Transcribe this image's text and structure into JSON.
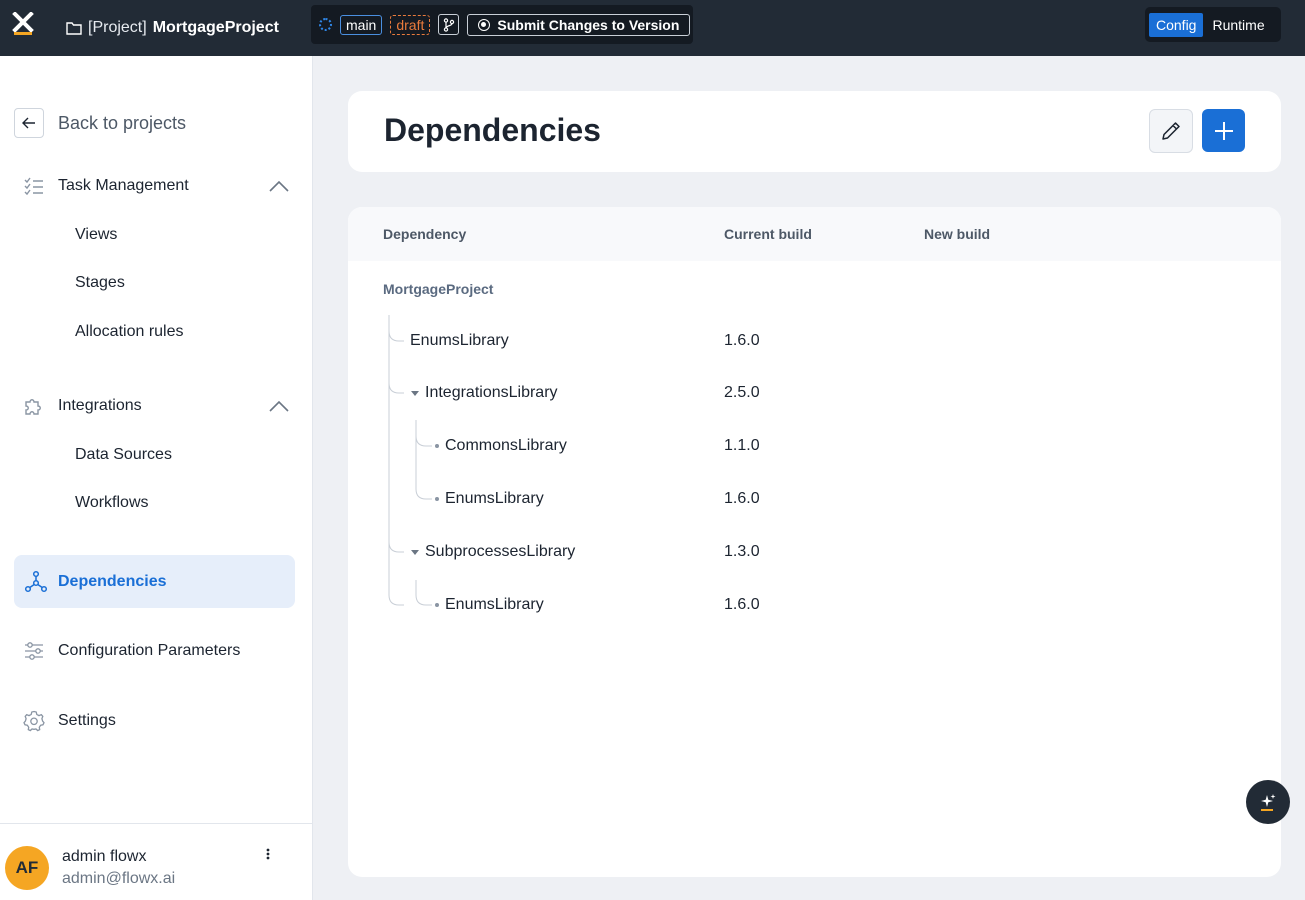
{
  "topbar": {
    "project_prefix": "[Project]",
    "project_name": "MortgageProject",
    "branch": "main",
    "state": "draft",
    "submit_label": "Submit Changes to Version",
    "modes": [
      "Config",
      "Runtime"
    ],
    "active_mode": "Config",
    "accent": "#1a6fd6"
  },
  "sidebar": {
    "back_label": "Back to projects",
    "sections": [
      {
        "label": "Task Management",
        "icon": "checklist-icon",
        "items": [
          "Views",
          "Stages",
          "Allocation rules"
        ]
      },
      {
        "label": "Integrations",
        "icon": "puzzle-icon",
        "items": [
          "Data Sources",
          "Workflows"
        ]
      }
    ],
    "active_item": "Dependencies",
    "config_params": "Configuration Parameters",
    "settings": "Settings"
  },
  "user": {
    "initials": "AF",
    "name": "admin flowx",
    "email": "admin@flowx.ai"
  },
  "page": {
    "title": "Dependencies"
  },
  "table": {
    "headers": [
      "Dependency",
      "Current build",
      "New build"
    ],
    "root": "MortgageProject",
    "rows": [
      {
        "name": "EnumsLibrary",
        "version": "1.6.0"
      },
      {
        "name": "IntegrationsLibrary",
        "version": "2.5.0"
      },
      {
        "name": "CommonsLibrary",
        "version": "1.1.0"
      },
      {
        "name": "EnumsLibrary",
        "version": "1.6.0"
      },
      {
        "name": "SubprocessesLibrary",
        "version": "1.3.0"
      },
      {
        "name": "EnumsLibrary",
        "version": "1.6.0"
      }
    ]
  }
}
